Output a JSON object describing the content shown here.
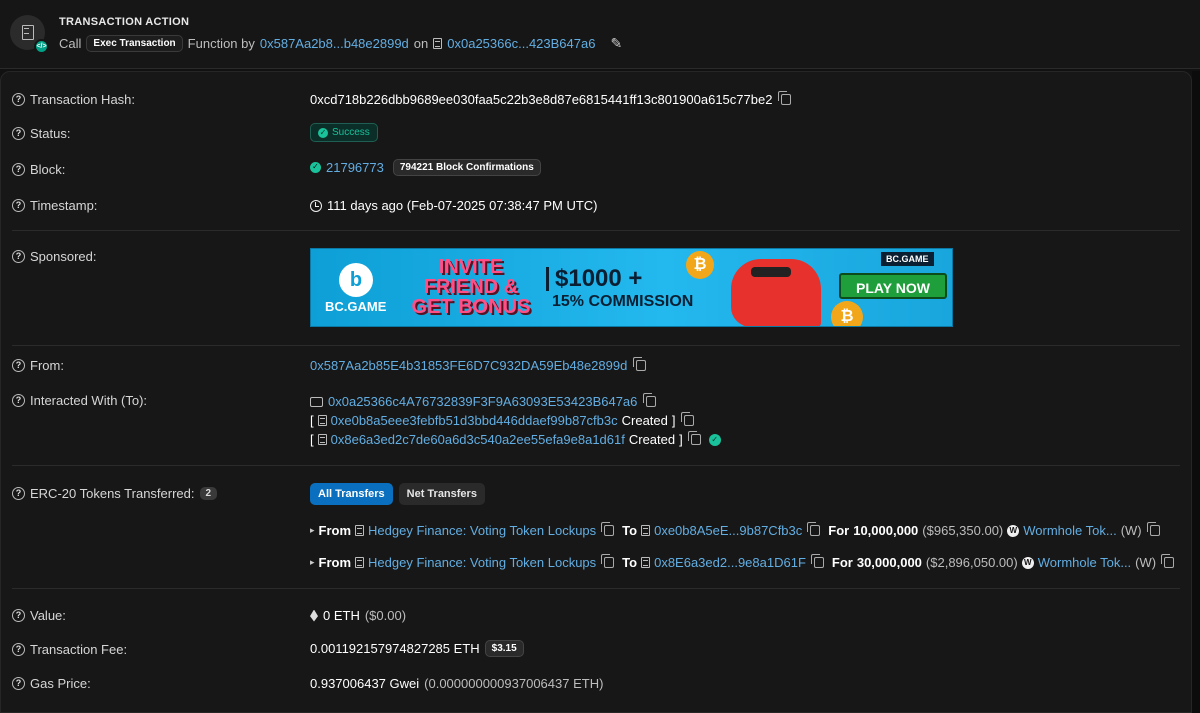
{
  "action": {
    "title": "TRANSACTION ACTION",
    "call": "Call",
    "method": "Exec Transaction",
    "function_by": "Function by",
    "from_addr": "0x587Aa2b8...b48e2899d",
    "on": "on",
    "contract": "0x0a25366c...423B647a6"
  },
  "labels": {
    "hash": "Transaction Hash:",
    "status": "Status:",
    "block": "Block:",
    "timestamp": "Timestamp:",
    "sponsored": "Sponsored:",
    "from": "From:",
    "to": "Interacted With (To):",
    "erc20": "ERC-20 Tokens Transferred:",
    "value": "Value:",
    "fee": "Transaction Fee:",
    "gas": "Gas Price:"
  },
  "tx": {
    "hash": "0xcd718b226dbb9689ee030faa5c22b3e8d87e6815441ff13c801900a615c77be2",
    "status": "Success",
    "block": "21796773",
    "confirmations": "794221 Block Confirmations",
    "timestamp": "111 days ago (Feb-07-2025 07:38:47 PM UTC)",
    "from": "0x587Aa2b85E4b31853FE6D7C932DA59Eb48e2899d",
    "to": "0x0a25366c4A76732839F3F9A63093E53423B647a6",
    "created": [
      {
        "addr": "0xe0b8a5eee3febfb51d3bbd446ddaef99b87cfb3c",
        "word": "Created"
      },
      {
        "addr": "0x8e6a3ed2c7de60a6d3c540a2ee55efa9e8a1d61f",
        "word": "Created"
      }
    ],
    "erc20_count": "2",
    "tab_all": "All Transfers",
    "tab_net": "Net Transfers",
    "transfers": [
      {
        "from_word": "From",
        "from": "Hedgey Finance: Voting Token Lockups",
        "to_word": "To",
        "to": "0xe0b8A5eE...9b87Cfb3c",
        "for_word": "For",
        "amount": "10,000,000",
        "usd": "($965,350.00)",
        "token": "Wormhole Tok...",
        "sym": "(W)"
      },
      {
        "from_word": "From",
        "from": "Hedgey Finance: Voting Token Lockups",
        "to_word": "To",
        "to": "0x8E6a3ed2...9e8a1D61F",
        "for_word": "For",
        "amount": "30,000,000",
        "usd": "($2,896,050.00)",
        "token": "Wormhole Tok...",
        "sym": "(W)"
      }
    ],
    "value": "0 ETH",
    "value_usd": "($0.00)",
    "fee": "0.001192157974827285 ETH",
    "fee_usd": "$3.15",
    "gas": "0.937006437 Gwei",
    "gas_eth": "(0.000000000937006437 ETH)"
  },
  "banner": {
    "brand": "BC.GAME",
    "invite": "INVITE FRIEND & GET BONUS",
    "amount": "$1000 +",
    "commission": "15% COMMISSION",
    "cta": "PLAY NOW",
    "tag": "BC.GAME"
  }
}
